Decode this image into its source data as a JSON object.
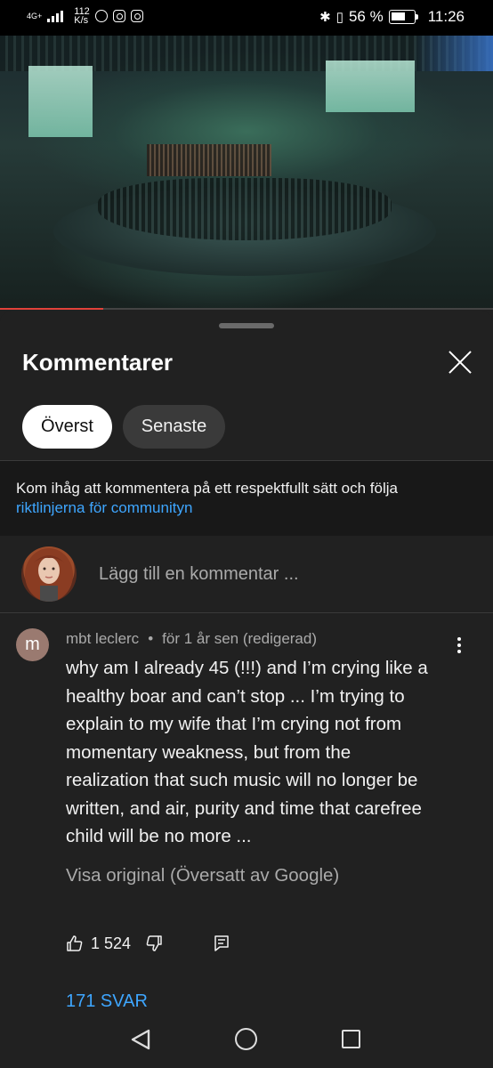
{
  "status_bar": {
    "network_type": "4G+",
    "speed_value": "112",
    "speed_unit": "K/s",
    "battery_percent": "56 %",
    "time": "11:26",
    "icons": [
      "signal-icon",
      "messenger-icon",
      "instagram-icon",
      "instagram-icon",
      "bluetooth-icon",
      "vibrate-icon",
      "battery-icon"
    ]
  },
  "video": {
    "progress_fraction": 0.21,
    "progress_color": "#e0423a"
  },
  "comments_panel": {
    "title": "Kommentarer",
    "tabs": [
      {
        "label": "Överst",
        "active": true
      },
      {
        "label": "Senaste",
        "active": false
      }
    ],
    "notice_text": "Kom ihåg att kommentera på ett respektfullt sätt och följa",
    "notice_link": "riktlinjerna för communityn",
    "add_comment_placeholder": "Lägg till en kommentar ...",
    "link_color": "#3ea6ff"
  },
  "comment": {
    "avatar_letter": "m",
    "author": "mbt leclerc",
    "separator": "•",
    "timestamp": "för 1 år sen (redigerad)",
    "text": "why am I already 45 (!!!) and I’m crying like a\nhealthy boar and can’t stop ... I’m trying to\nexplain to my wife that I’m crying not from\nmomentary weakness, but from the\nrealization that such music will no longer be\nwritten, and air, purity and time that carefree\nchild will be no more ...",
    "translation_toggle": "Visa original (Översatt av Google)",
    "like_count": "1 524",
    "replies_label": "171 SVAR"
  }
}
